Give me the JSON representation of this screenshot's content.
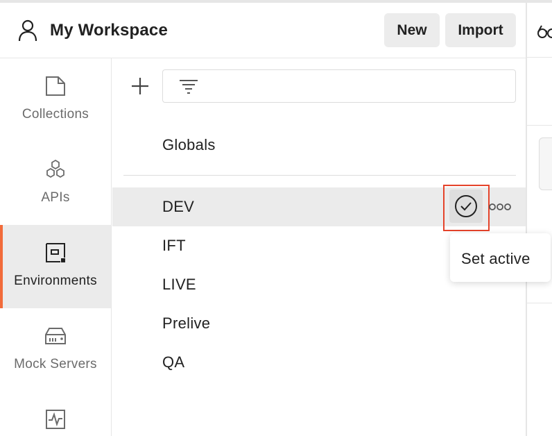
{
  "header": {
    "workspace_title": "My Workspace",
    "new_label": "New",
    "import_label": "Import",
    "workspace_icon": "user-icon"
  },
  "sidebar": {
    "items": [
      {
        "label": "Collections",
        "icon": "collection-icon",
        "active": false
      },
      {
        "label": "APIs",
        "icon": "apis-icon",
        "active": false
      },
      {
        "label": "Environments",
        "icon": "environments-icon",
        "active": true
      },
      {
        "label": "Mock Servers",
        "icon": "mock-server-icon",
        "active": false
      },
      {
        "label": "",
        "icon": "monitor-icon",
        "active": false
      }
    ]
  },
  "environments": {
    "globals_label": "Globals",
    "items": [
      {
        "label": "DEV",
        "hovered": true
      },
      {
        "label": "IFT"
      },
      {
        "label": "LIVE"
      },
      {
        "label": "Prelive"
      },
      {
        "label": "QA"
      }
    ],
    "tooltip": "Set active"
  },
  "colors": {
    "accent": "#f26b3a",
    "highlight_border": "#e5432a",
    "active_bg": "#ebebeb",
    "button_bg": "#ececec"
  }
}
